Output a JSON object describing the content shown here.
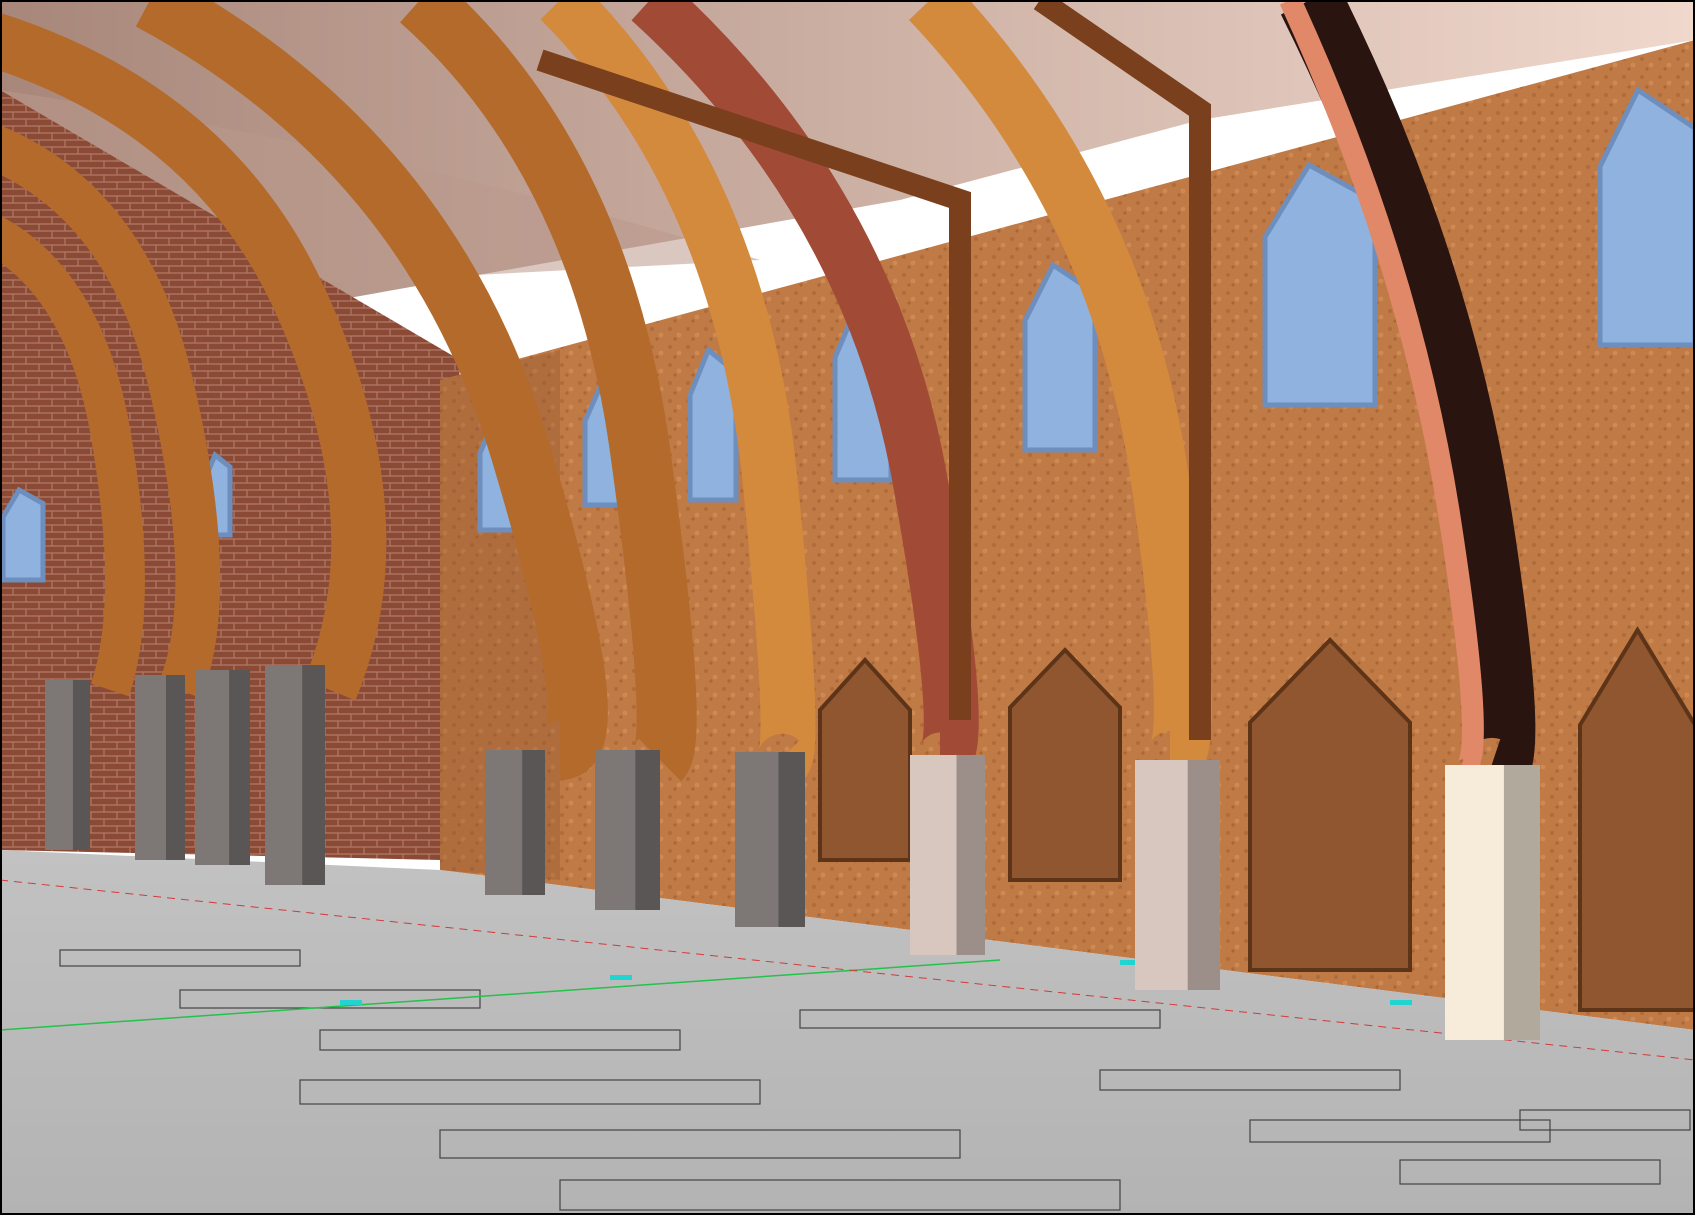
{
  "scene": {
    "colors": {
      "ceiling": "#e6c9bd",
      "ceiling_shadow": "#b9998c",
      "plaster_wall": "#c07a45",
      "plaster_wall_dark": "#8f5630",
      "brick": "#8a4a36",
      "brick_mortar": "#b07a66",
      "timber_light": "#d48a3c",
      "timber": "#b36a2a",
      "timber_dark": "#7a3f1c",
      "timber_red": "#a14a35",
      "timber_salmon": "#e08868",
      "timber_black": "#2a1410",
      "window_glass": "#8fb2df",
      "window_frame": "#6e8fbe",
      "pillar_grey": "#7d7876",
      "pillar_pale": "#d8c7bf",
      "pillar_cream": "#f6ecd9",
      "floor": "#b9b9b9",
      "floor_line": "#444444",
      "guide_green": "#23c24a",
      "guide_red": "#d23a3a",
      "guide_cyan": "#22d4d0",
      "frame_border": "#000000"
    },
    "element_names": [
      "vaulted-ceiling",
      "brick-wall",
      "plaster-side-wall",
      "curved-timber-rib",
      "stone-pier",
      "arched-window",
      "arched-niche",
      "floor-plan-outline"
    ]
  }
}
